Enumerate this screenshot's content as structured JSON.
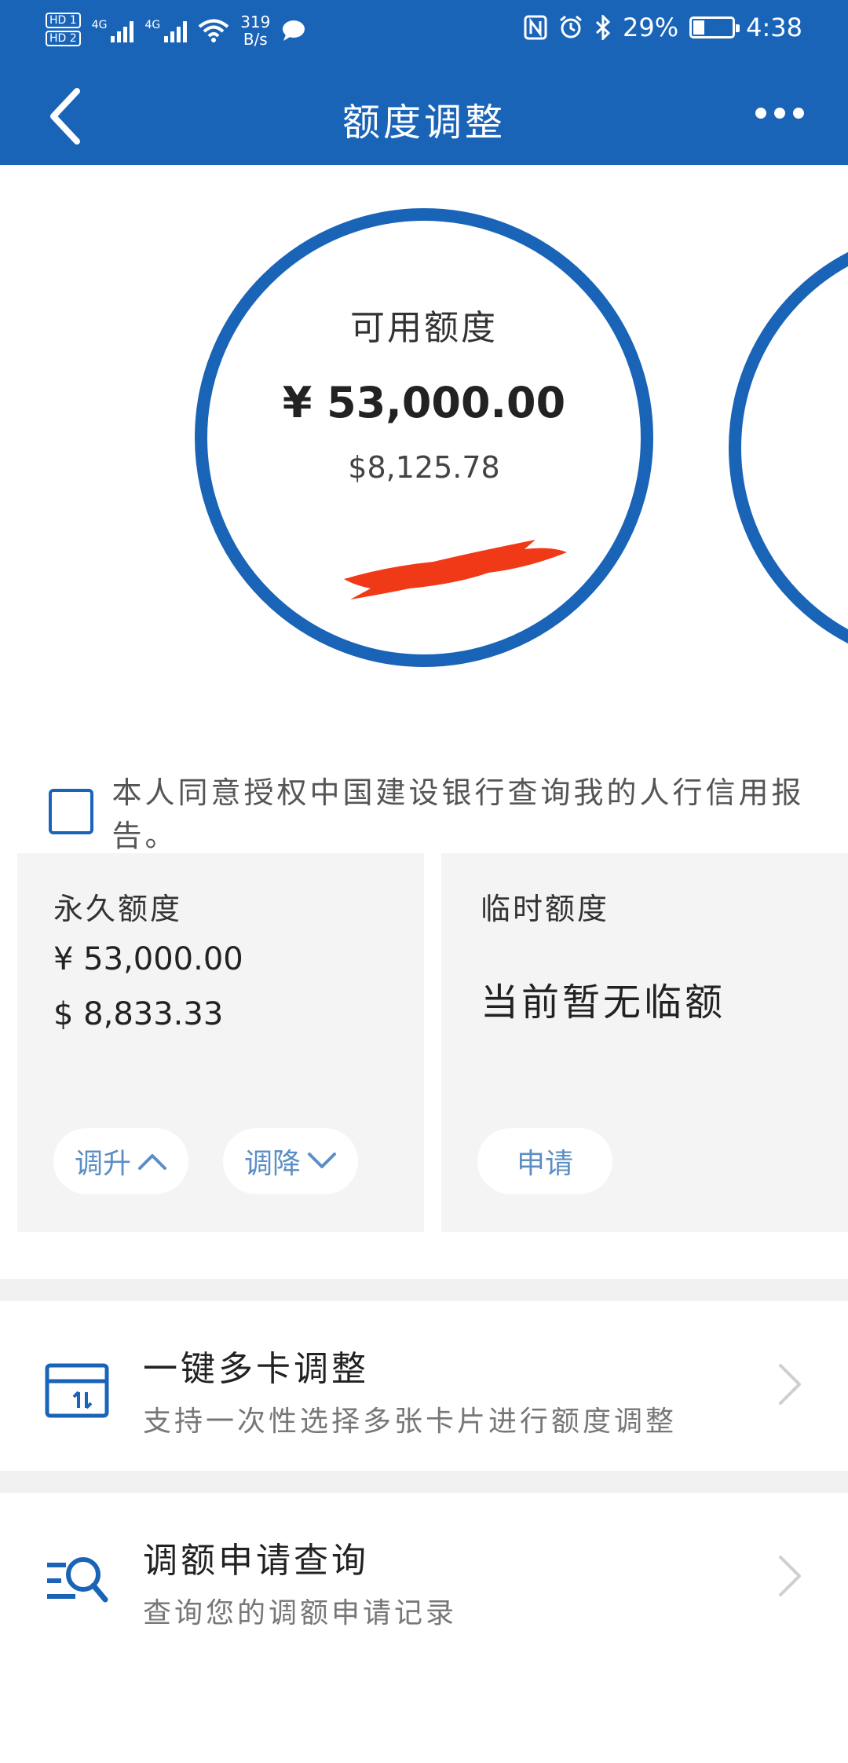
{
  "status_bar": {
    "hd1": "HD 1",
    "hd2": "HD 2",
    "net1": "4G",
    "net2": "4G",
    "speed_value": "319",
    "speed_unit": "B/s",
    "battery": "29%",
    "time": "4:38",
    "battery_level": 0.29
  },
  "nav": {
    "title": "额度调整"
  },
  "available": {
    "label": "可用额度",
    "amount_cny": "¥ 53,000.00",
    "amount_usd": "$8,125.78"
  },
  "consent": {
    "text": "本人同意授权中国建设银行查询我的人行信用报告。"
  },
  "permanent": {
    "title": "永久额度",
    "cny": "¥ 53,000.00",
    "usd": "$ 8,833.33",
    "increase_label": "调升",
    "decrease_label": "调降"
  },
  "temporary": {
    "title": "临时额度",
    "none_text": "当前暂无临额",
    "apply_label": "申请"
  },
  "list": [
    {
      "title": "一键多卡调整",
      "subtitle": "支持一次性选择多张卡片进行额度调整"
    },
    {
      "title": "调额申请查询",
      "subtitle": "查询您的调额申请记录"
    }
  ],
  "colors": {
    "brand": "#1a64b8",
    "pill_text": "#5b8ec4",
    "redaction": "#f03a17"
  }
}
